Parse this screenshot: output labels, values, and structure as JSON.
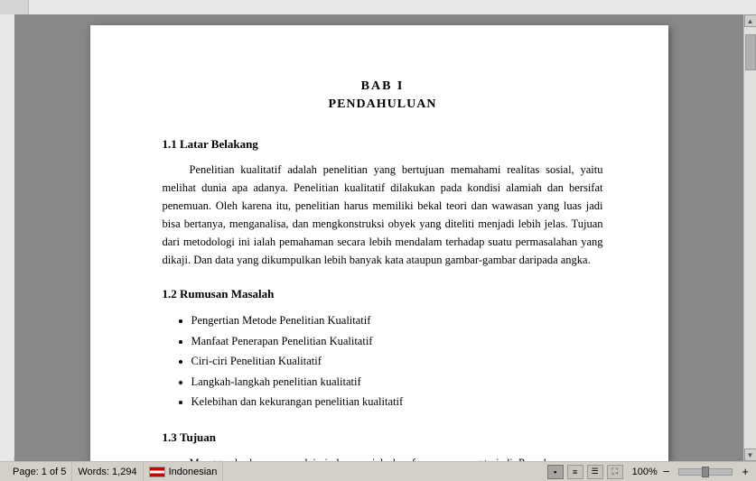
{
  "ruler": {
    "top_height": 16,
    "left_width": 16
  },
  "document": {
    "chapter_number": "BAB  I",
    "chapter_title": "PENDAHULUAN",
    "section1": {
      "number": "1.1",
      "title": "Latar Belakang",
      "paragraph": "Penelitian kualitatif adalah penelitian yang bertujuan memahami realitas sosial, yaitu melihat dunia apa adanya. Penelitian kualitatif dilakukan pada kondisi alamiah dan bersifat penemuan. Oleh karena itu, penelitian harus memiliki bekal teori dan wawasan yang luas jadi bisa bertanya, menganalisa, dan mengkonstruksi obyek yang diteliti menjadi lebih jelas. Tujuan dari metodologi ini ialah pemahaman secara lebih mendalam terhadap suatu permasalahan yang dikaji. Dan data yang dikumpulkan lebih banyak kata ataupun gambar-gambar daripada angka."
    },
    "section2": {
      "number": "1.2",
      "title": "Rumusan Masalah",
      "bullets": [
        "Pengertian Metode Penelitian Kualitatif",
        "Manfaat Penerapan Penelitian Kualitatif",
        "Ciri-ciri Penelitian Kualitatif",
        "Langkah-langkah penelitian kualitatif",
        "Kelebihan dan kekurangan penelitian kualitatif"
      ]
    },
    "section3": {
      "number": "1.3",
      "title": "Tujuan",
      "paragraph": "Menggambarkan, mempelajari, dan menjelaskan fenomena yang terjadi. Pemahaman"
    }
  },
  "statusbar": {
    "page_info": "Page: 1 of 5",
    "words_info": "Words: 1,294",
    "language": "Indonesian",
    "zoom": "100%",
    "zoom_minus": "−",
    "zoom_plus": "+"
  }
}
